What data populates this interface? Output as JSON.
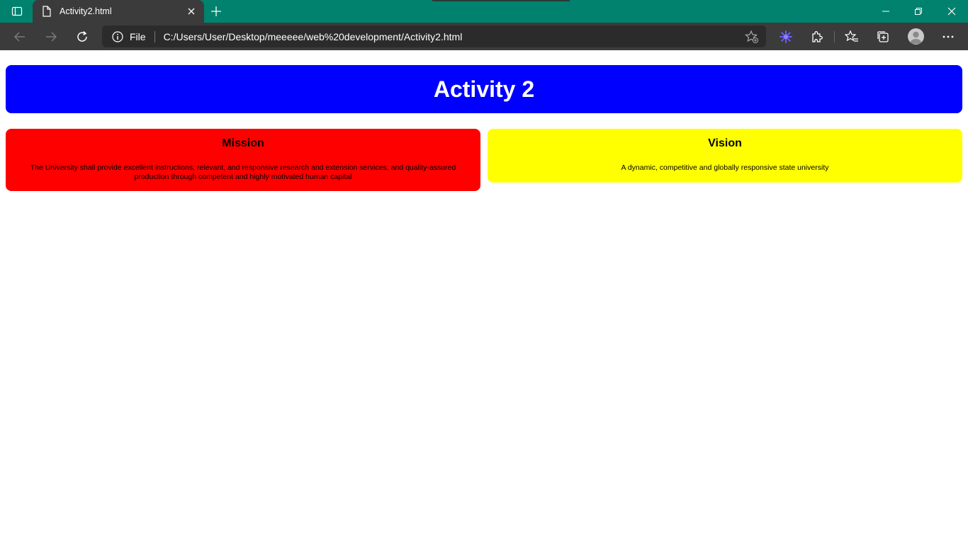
{
  "browser": {
    "tab_title": "Activity2.html",
    "address": {
      "scheme_label": "File",
      "url": "C:/Users/User/Desktop/meeeee/web%20development/Activity2.html"
    },
    "colors": {
      "titlebar": "#00826f",
      "toolbar": "#3b3b3b",
      "omnibox": "#2b2b2b"
    }
  },
  "page": {
    "header": {
      "title": "Activity 2",
      "color": "#0000ff"
    },
    "mission": {
      "heading": "Mission",
      "text": "The University shall provide excellent instructions, relevant, and responsive research and extension services, and quality-assured production through competent and highly motivated human capital",
      "color": "#ff0000"
    },
    "vision": {
      "heading": "Vision",
      "text": "A dynamic, competitive and globally responsive state university",
      "color": "#ffff00"
    }
  }
}
